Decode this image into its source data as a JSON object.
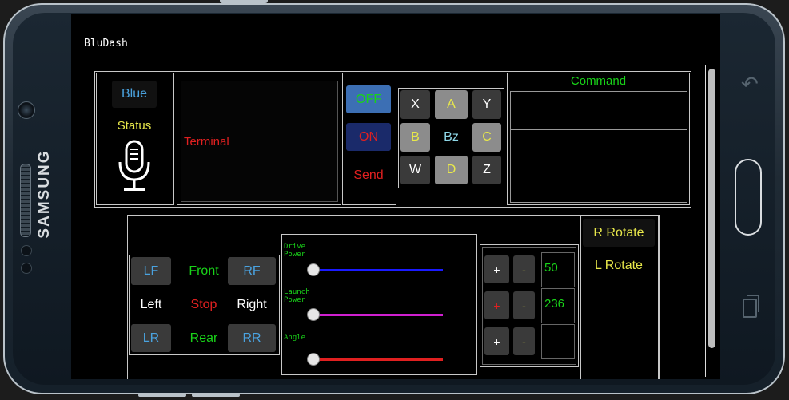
{
  "app": {
    "title": "BluDash"
  },
  "device": {
    "brand": "SAMSUNG"
  },
  "status_panel": {
    "blue_label": "Blue",
    "status_label": "Status",
    "mic_icon": "microphone-icon"
  },
  "terminal": {
    "label": "Terminal"
  },
  "power": {
    "off_label": "OFF",
    "on_label": "ON",
    "send_label": "Send"
  },
  "keypad": {
    "keys": [
      {
        "label": "X",
        "color": "#ffffff",
        "bg": "#3a3a3a"
      },
      {
        "label": "A",
        "color": "#e8e84a",
        "bg": "#8c8c8c"
      },
      {
        "label": "Y",
        "color": "#ffffff",
        "bg": "#3a3a3a"
      },
      {
        "label": "B",
        "color": "#e8e84a",
        "bg": "#8c8c8c"
      },
      {
        "label": "Bz",
        "color": "#8fd8e8",
        "bg": "#000000"
      },
      {
        "label": "C",
        "color": "#e8e84a",
        "bg": "#8c8c8c"
      },
      {
        "label": "W",
        "color": "#ffffff",
        "bg": "#3a3a3a"
      },
      {
        "label": "D",
        "color": "#e8e84a",
        "bg": "#8c8c8c"
      },
      {
        "label": "Z",
        "color": "#ffffff",
        "bg": "#3a3a3a"
      }
    ]
  },
  "command": {
    "label": "Command",
    "value": ""
  },
  "drive_pad": {
    "buttons": [
      {
        "label": "LF",
        "color": "#4aa3e0",
        "bg": "#3a3a3a"
      },
      {
        "label": "Front",
        "color": "#19d319",
        "bg": "#000000"
      },
      {
        "label": "RF",
        "color": "#4aa3e0",
        "bg": "#3a3a3a"
      },
      {
        "label": "Left",
        "color": "#ffffff",
        "bg": "#000000"
      },
      {
        "label": "Stop",
        "color": "#e02020",
        "bg": "#000000"
      },
      {
        "label": "Right",
        "color": "#ffffff",
        "bg": "#000000"
      },
      {
        "label": "LR",
        "color": "#4aa3e0",
        "bg": "#3a3a3a"
      },
      {
        "label": "Rear",
        "color": "#19d319",
        "bg": "#000000"
      },
      {
        "label": "RR",
        "color": "#4aa3e0",
        "bg": "#3a3a3a"
      }
    ]
  },
  "sliders": [
    {
      "label_line1": "Drive",
      "label_line2": "Power",
      "value": 0,
      "color": "#1a1aff"
    },
    {
      "label_line1": "Launch",
      "label_line2": "Power",
      "value": 0,
      "color": "#d020d0"
    },
    {
      "label_line1": "Angle",
      "label_line2": "",
      "value": 0,
      "color": "#e02020"
    }
  ],
  "steppers": {
    "rows": [
      {
        "plus": "+",
        "minus": "-",
        "plus_color": "#ffffff",
        "value": "50"
      },
      {
        "plus": "+",
        "minus": "-",
        "plus_color": "#e02020",
        "value": "236"
      },
      {
        "plus": "+",
        "minus": "-",
        "plus_color": "#ffffff",
        "value": ""
      }
    ]
  },
  "rotate": {
    "right_label": "R Rotate",
    "left_label": "L Rotate"
  },
  "colors": {
    "accent_green": "#19d319",
    "accent_red": "#e02020",
    "accent_yellow": "#e8e84a",
    "off_button_bg": "#3c6fb4",
    "on_button_bg": "#1a2a6a"
  }
}
